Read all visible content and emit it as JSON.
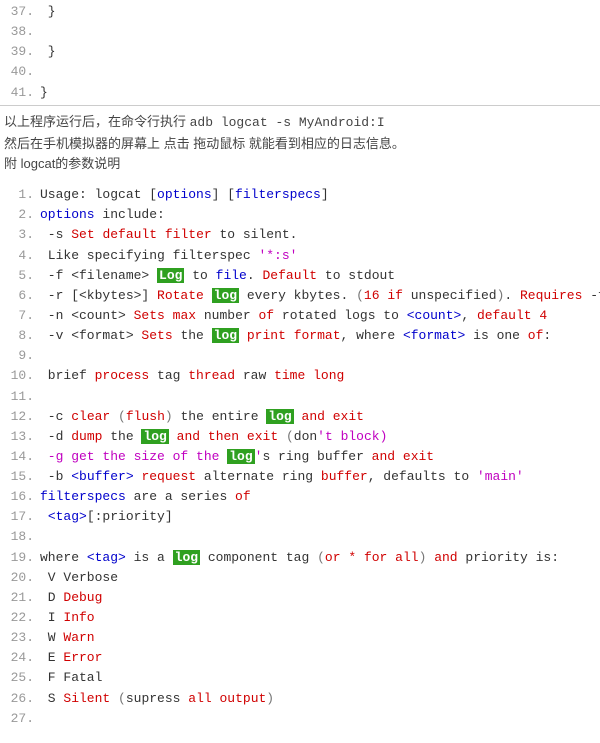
{
  "top_code": [
    {
      "n": "37.",
      "c": " }"
    },
    {
      "n": "38.",
      "c": ""
    },
    {
      "n": "39.",
      "c": " }"
    },
    {
      "n": "40.",
      "c": ""
    },
    {
      "n": "41.",
      "c": "}"
    }
  ],
  "desc": {
    "l1a": "以上程序运行后，在命令行执行  ",
    "l1b": "adb logcat -s MyAndroid:I",
    "l2": "然后在手机模拟器的屏幕上 点击 拖动鼠标 就能看到相应的日志信息。",
    "l3": "附 logcat的参数说明"
  },
  "lines": {
    "l1": {
      "n": "1.",
      "p": [
        [
          "",
          "Usage: logcat ["
        ],
        [
          "blue",
          "options"
        ],
        [
          "",
          "] ["
        ],
        [
          "blue",
          "filterspecs"
        ],
        [
          "",
          "]"
        ]
      ]
    },
    "l2": {
      "n": "2.",
      "p": [
        [
          "blue",
          "options"
        ],
        [
          "",
          " include:"
        ]
      ]
    },
    "l3": {
      "n": "3.",
      "p": [
        [
          "",
          " -s "
        ],
        [
          "red",
          "Set"
        ],
        [
          "",
          " "
        ],
        [
          "red",
          "default"
        ],
        [
          "",
          " "
        ],
        [
          "red",
          "filter"
        ],
        [
          "",
          " to silent."
        ]
      ]
    },
    "l4": {
      "n": "4.",
      "p": [
        [
          "",
          " Like specifying filterspec "
        ],
        [
          "str",
          "'*:s'"
        ]
      ]
    },
    "l5": {
      "n": "5.",
      "p": [
        [
          "",
          " -f <filename> "
        ],
        [
          "log",
          "Log"
        ],
        [
          "",
          " to "
        ],
        [
          "blue",
          "file"
        ],
        [
          "",
          ". "
        ],
        [
          "red",
          "Default"
        ],
        [
          "",
          " to stdout"
        ]
      ]
    },
    "l6": {
      "n": "6.",
      "p": [
        [
          "",
          " -r [<kbytes>] "
        ],
        [
          "red",
          "Rotate"
        ],
        [
          "",
          " "
        ],
        [
          "log",
          "log"
        ],
        [
          "",
          " every kbytes. "
        ],
        [
          "gray",
          "("
        ],
        [
          "red",
          "16"
        ],
        [
          "",
          " "
        ],
        [
          "red",
          "if"
        ],
        [
          "",
          " unspecified"
        ],
        [
          "gray",
          ")"
        ],
        [
          "",
          ". "
        ],
        [
          "red",
          "Requires"
        ],
        [
          "",
          " -f"
        ]
      ]
    },
    "l7": {
      "n": "7.",
      "p": [
        [
          "",
          " -n <count> "
        ],
        [
          "red",
          "Sets"
        ],
        [
          "",
          " "
        ],
        [
          "red",
          "max"
        ],
        [
          "",
          " number "
        ],
        [
          "red",
          "of"
        ],
        [
          "",
          " rotated logs to "
        ],
        [
          "blue",
          "<count>"
        ],
        [
          "",
          ", "
        ],
        [
          "red",
          "default"
        ],
        [
          "",
          " "
        ],
        [
          "red",
          "4"
        ]
      ]
    },
    "l8": {
      "n": "8.",
      "p": [
        [
          "",
          " -v <format> "
        ],
        [
          "red",
          "Sets"
        ],
        [
          "",
          " the "
        ],
        [
          "log",
          "log"
        ],
        [
          "",
          " "
        ],
        [
          "red",
          "print"
        ],
        [
          "",
          " "
        ],
        [
          "red",
          "format"
        ],
        [
          "",
          ", where "
        ],
        [
          "blue",
          "<format>"
        ],
        [
          "",
          " is one "
        ],
        [
          "red",
          "of"
        ],
        [
          "",
          ":"
        ]
      ]
    },
    "l9": {
      "n": "9.",
      "p": [
        [
          "",
          ""
        ]
      ]
    },
    "l10": {
      "n": "10.",
      "p": [
        [
          "",
          " brief "
        ],
        [
          "red",
          "process"
        ],
        [
          "",
          " tag "
        ],
        [
          "red",
          "thread"
        ],
        [
          "",
          " raw "
        ],
        [
          "red",
          "time"
        ],
        [
          "",
          " "
        ],
        [
          "red",
          "long"
        ]
      ]
    },
    "l11": {
      "n": "11.",
      "p": [
        [
          "",
          ""
        ]
      ]
    },
    "l12": {
      "n": "12.",
      "p": [
        [
          "",
          " -c "
        ],
        [
          "red",
          "clear"
        ],
        [
          "",
          " "
        ],
        [
          "gray",
          "("
        ],
        [
          "red",
          "flush"
        ],
        [
          "gray",
          ")"
        ],
        [
          "",
          " the entire "
        ],
        [
          "log",
          "log"
        ],
        [
          "",
          " "
        ],
        [
          "red",
          "and"
        ],
        [
          "",
          " "
        ],
        [
          "red",
          "exit"
        ]
      ]
    },
    "l13": {
      "n": "13.",
      "p": [
        [
          "",
          " -d "
        ],
        [
          "red",
          "dump"
        ],
        [
          "",
          " the "
        ],
        [
          "log",
          "log"
        ],
        [
          "",
          " "
        ],
        [
          "red",
          "and"
        ],
        [
          "",
          " "
        ],
        [
          "red",
          "then"
        ],
        [
          "",
          " "
        ],
        [
          "red",
          "exit"
        ],
        [
          "",
          " "
        ],
        [
          "gray",
          "("
        ],
        [
          "",
          "don"
        ],
        [
          "str",
          "'t block)"
        ]
      ]
    },
    "l14": {
      "n": "14.",
      "p": [
        [
          "str",
          " -g get the size of the "
        ],
        [
          "log",
          "log"
        ],
        [
          "str",
          "'"
        ],
        [
          "",
          "s ring buffer "
        ],
        [
          "red",
          "and"
        ],
        [
          "",
          " "
        ],
        [
          "red",
          "exit"
        ]
      ]
    },
    "l15": {
      "n": "15.",
      "p": [
        [
          "",
          " -b "
        ],
        [
          "blue",
          "<buffer>"
        ],
        [
          "",
          " "
        ],
        [
          "red",
          "request"
        ],
        [
          "",
          " alternate ring "
        ],
        [
          "red",
          "buffer"
        ],
        [
          "",
          ", defaults to "
        ],
        [
          "str",
          "'main'"
        ]
      ]
    },
    "l16": {
      "n": "16.",
      "p": [
        [
          "blue",
          "filterspecs"
        ],
        [
          "",
          " are a series "
        ],
        [
          "red",
          "of"
        ]
      ]
    },
    "l17": {
      "n": "17.",
      "p": [
        [
          "",
          " "
        ],
        [
          "blue",
          "<tag>"
        ],
        [
          "",
          "[:priority]"
        ]
      ]
    },
    "l18": {
      "n": "18.",
      "p": [
        [
          "",
          ""
        ]
      ]
    },
    "l19": {
      "n": "19.",
      "p": [
        [
          "",
          "where "
        ],
        [
          "blue",
          "<tag>"
        ],
        [
          "",
          " is a "
        ],
        [
          "log",
          "log"
        ],
        [
          "",
          " component tag "
        ],
        [
          "gray",
          "("
        ],
        [
          "red",
          "or"
        ],
        [
          "",
          " "
        ],
        [
          "red",
          "*"
        ],
        [
          "",
          " "
        ],
        [
          "red",
          "for"
        ],
        [
          "",
          " "
        ],
        [
          "red",
          "all"
        ],
        [
          "gray",
          ")"
        ],
        [
          "",
          " "
        ],
        [
          "red",
          "and"
        ],
        [
          "",
          " priority is:"
        ]
      ]
    },
    "l20": {
      "n": "20.",
      "p": [
        [
          "",
          " V Verbose"
        ]
      ]
    },
    "l21": {
      "n": "21.",
      "p": [
        [
          "",
          " D "
        ],
        [
          "red",
          "Debug"
        ]
      ]
    },
    "l22": {
      "n": "22.",
      "p": [
        [
          "",
          " I "
        ],
        [
          "red",
          "Info"
        ]
      ]
    },
    "l23": {
      "n": "23.",
      "p": [
        [
          "",
          " W "
        ],
        [
          "red",
          "Warn"
        ]
      ]
    },
    "l24": {
      "n": "24.",
      "p": [
        [
          "",
          " E "
        ],
        [
          "red",
          "Error"
        ]
      ]
    },
    "l25": {
      "n": "25.",
      "p": [
        [
          "",
          " F Fatal"
        ]
      ]
    },
    "l26": {
      "n": "26.",
      "p": [
        [
          "",
          " S "
        ],
        [
          "red",
          "Silent"
        ],
        [
          "",
          " "
        ],
        [
          "gray",
          "("
        ],
        [
          "",
          "supress "
        ],
        [
          "red",
          "all"
        ],
        [
          "",
          " "
        ],
        [
          "red",
          "output"
        ],
        [
          "gray",
          ")"
        ]
      ]
    },
    "l27": {
      "n": "27.",
      "p": [
        [
          "",
          ""
        ]
      ]
    }
  }
}
